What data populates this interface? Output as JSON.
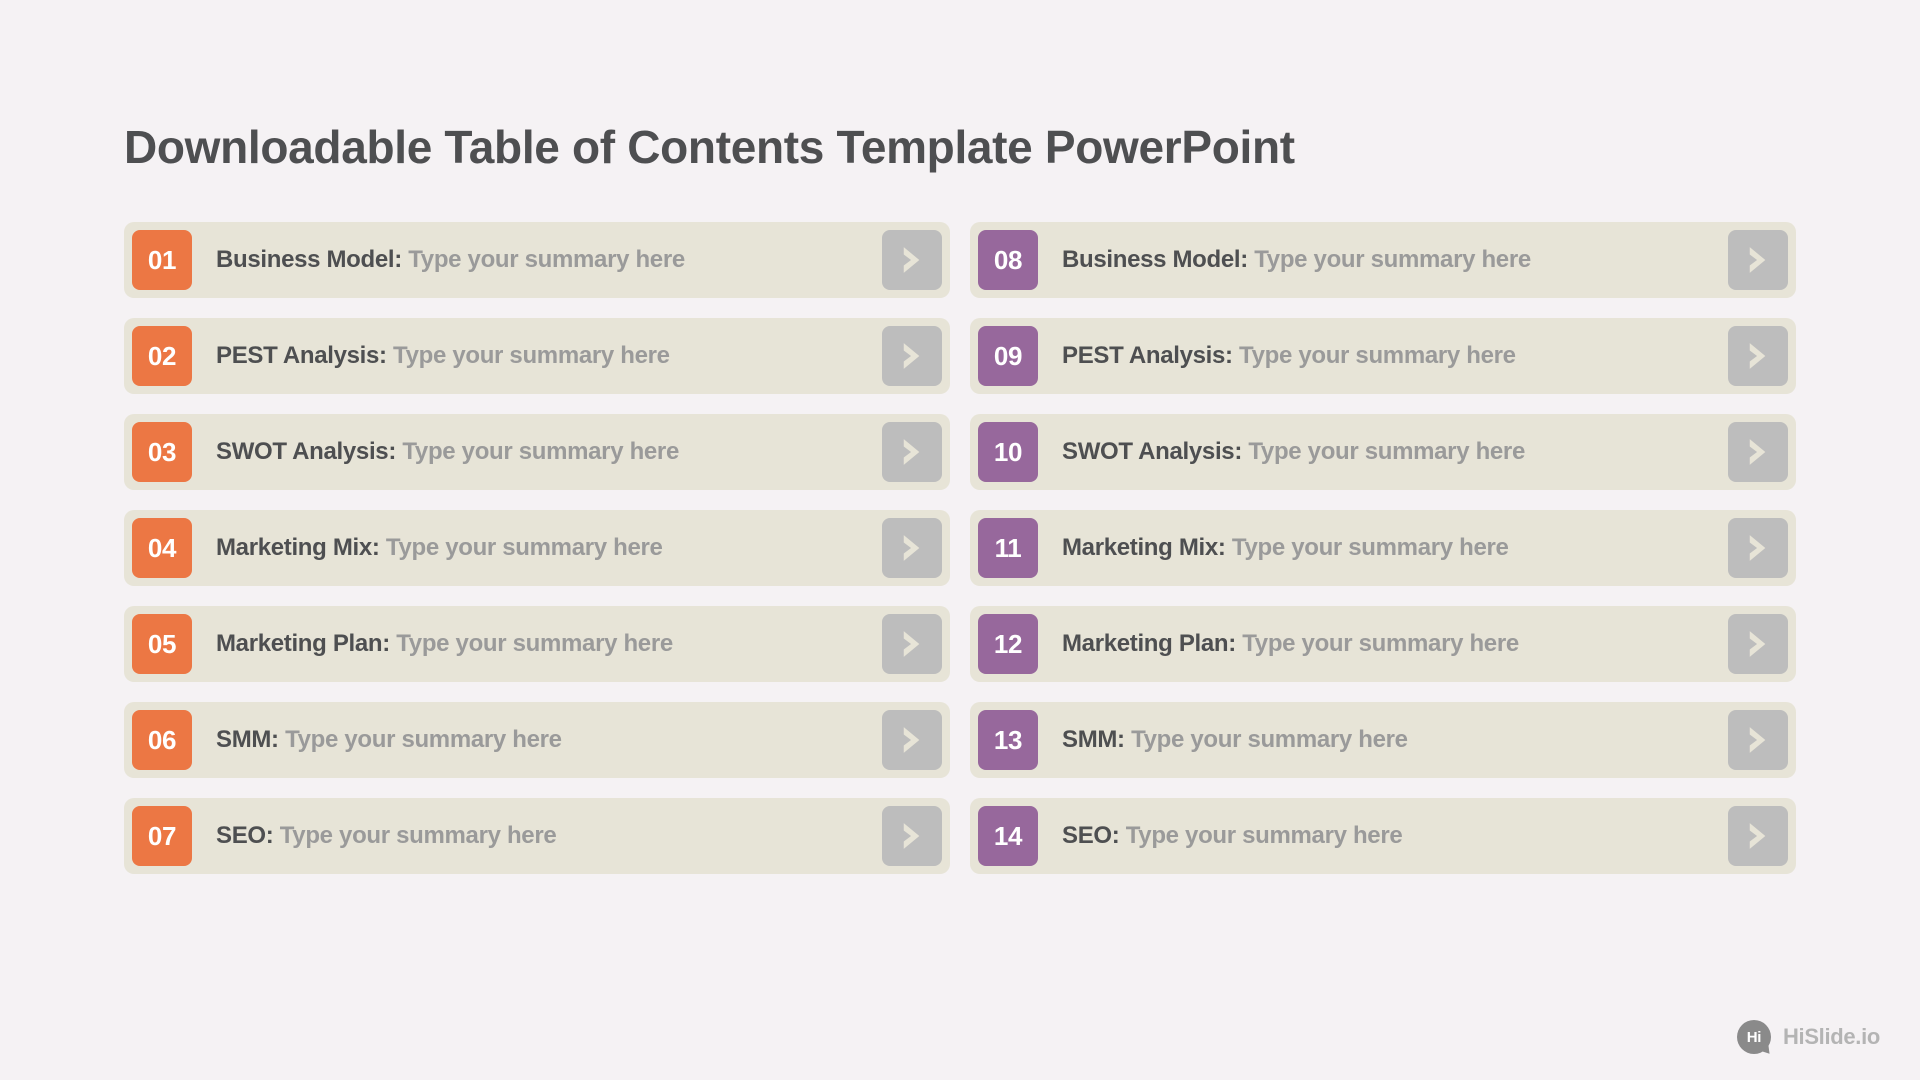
{
  "title": "Downloadable Table of Contents Template PowerPoint",
  "summary_placeholder": "Type your summary here",
  "colors": {
    "left": "#ec7744",
    "right": "#97689c"
  },
  "left": [
    {
      "num": "01",
      "label": "Business Model:"
    },
    {
      "num": "02",
      "label": "PEST Analysis:"
    },
    {
      "num": "03",
      "label": "SWOT Analysis:"
    },
    {
      "num": "04",
      "label": "Marketing Mix:"
    },
    {
      "num": "05",
      "label": "Marketing Plan:"
    },
    {
      "num": "06",
      "label": "SMM:"
    },
    {
      "num": "07",
      "label": "SEO:"
    }
  ],
  "right": [
    {
      "num": "08",
      "label": "Business Model:"
    },
    {
      "num": "09",
      "label": "PEST Analysis:"
    },
    {
      "num": "10",
      "label": "SWOT Analysis:"
    },
    {
      "num": "11",
      "label": "Marketing Mix:"
    },
    {
      "num": "12",
      "label": "Marketing Plan:"
    },
    {
      "num": "13",
      "label": "SMM:"
    },
    {
      "num": "14",
      "label": "SEO:"
    }
  ],
  "footer": {
    "badge": "Hi",
    "brand": "HiSlide.io"
  }
}
